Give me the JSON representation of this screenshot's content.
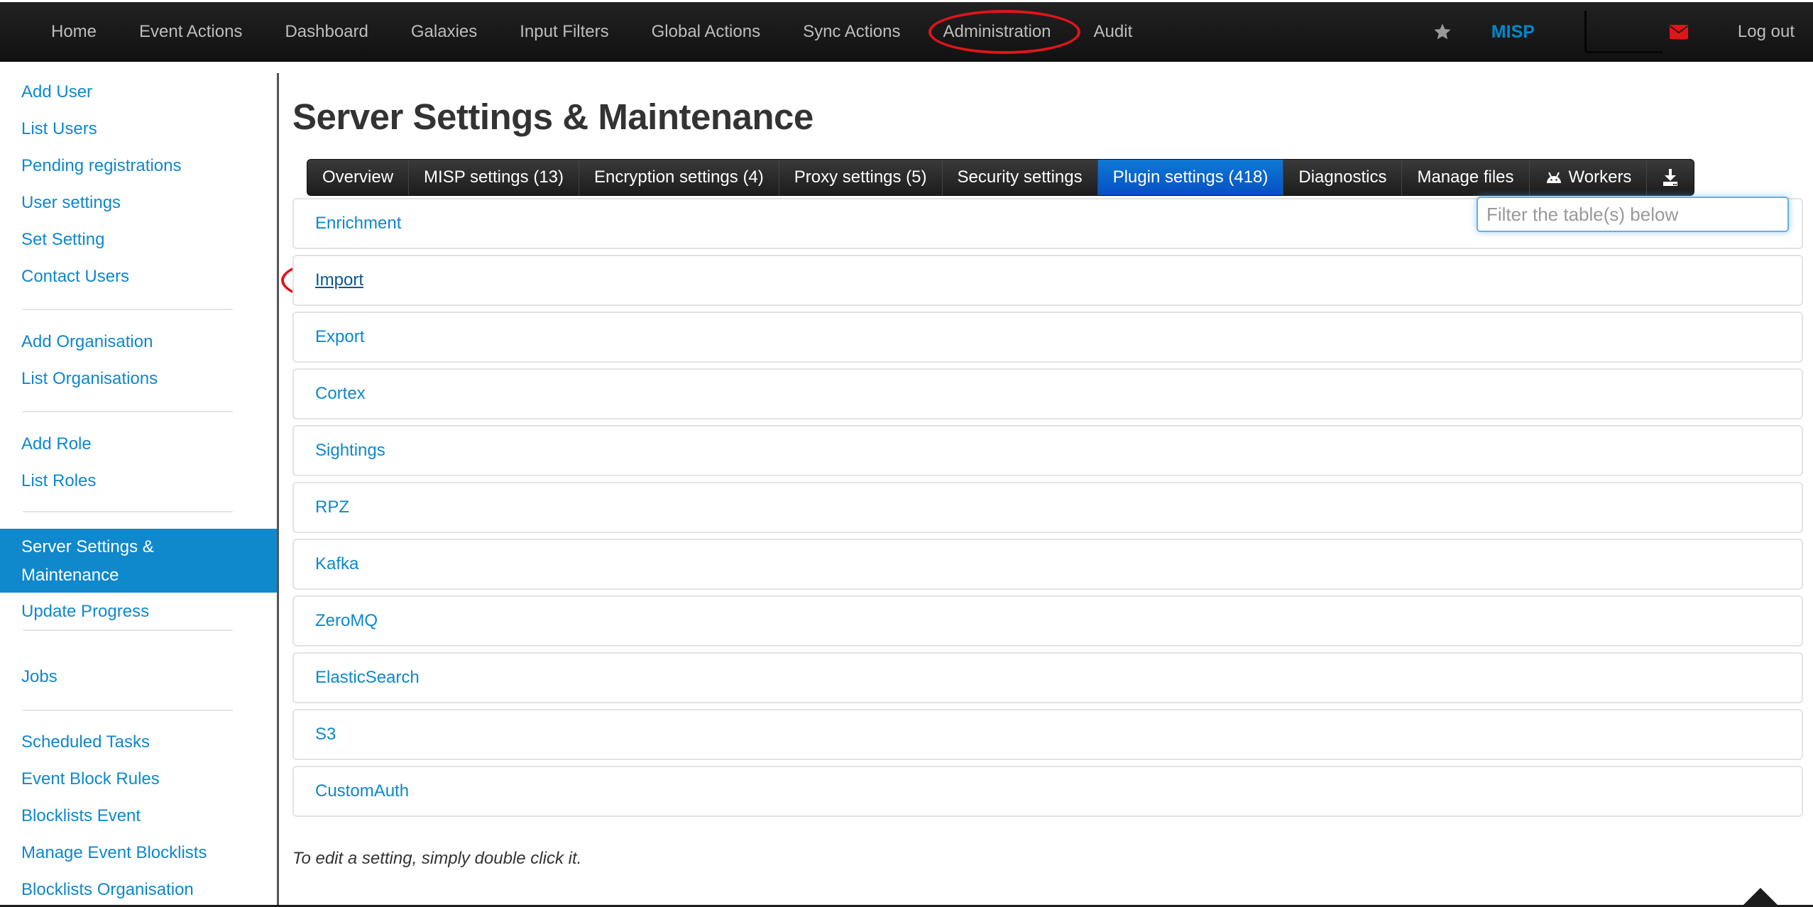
{
  "navbar": {
    "items": [
      "Home",
      "Event Actions",
      "Dashboard",
      "Galaxies",
      "Input Filters",
      "Global Actions",
      "Sync Actions",
      "Administration",
      "Audit"
    ],
    "brand": "MISP",
    "logout": "Log out",
    "icons": {
      "favourite": "star-icon",
      "notifications": "envelope-icon"
    },
    "highlighted_item": "Administration"
  },
  "sidebar": {
    "groups": [
      [
        "Add User",
        "List Users",
        "Pending registrations",
        "User settings",
        "Set Setting",
        "Contact Users"
      ],
      [
        "Add Organisation",
        "List Organisations"
      ],
      [
        "Add Role",
        "List Roles"
      ],
      [
        "Server Settings & Maintenance",
        "Update Progress"
      ],
      [
        "Jobs"
      ],
      [
        "Scheduled Tasks",
        "Event Block Rules",
        "Blocklists Event",
        "Manage Event Blocklists",
        "Blocklists Organisation"
      ]
    ],
    "active": "Server Settings & Maintenance"
  },
  "main": {
    "title": "Server Settings & Maintenance",
    "tabs": [
      {
        "label": "Overview"
      },
      {
        "label": "MISP settings (13)"
      },
      {
        "label": "Encryption settings (4)"
      },
      {
        "label": "Proxy settings (5)"
      },
      {
        "label": "Security settings"
      },
      {
        "label": "Plugin settings (418)",
        "active": true
      },
      {
        "label": "Diagnostics"
      },
      {
        "label": "Manage files"
      },
      {
        "label": "Workers",
        "icon": "android-icon"
      },
      {
        "label": "",
        "icon": "download-icon"
      }
    ],
    "filter": {
      "placeholder": "Filter the table(s) below",
      "value": ""
    },
    "plugin_sections": [
      "Enrichment",
      "Import",
      "Export",
      "Cortex",
      "Sightings",
      "RPZ",
      "Kafka",
      "ZeroMQ",
      "ElasticSearch",
      "S3",
      "CustomAuth"
    ],
    "highlighted_section": "Import",
    "hint": "To edit a setting, simply double click it."
  },
  "colors": {
    "link": "#0e88cc",
    "active_sidebar": "#1088cc",
    "active_tab": "#0550c4",
    "navbar": "#1b1b1b",
    "annotation": "#e3131a",
    "mail": "#e3131a"
  }
}
